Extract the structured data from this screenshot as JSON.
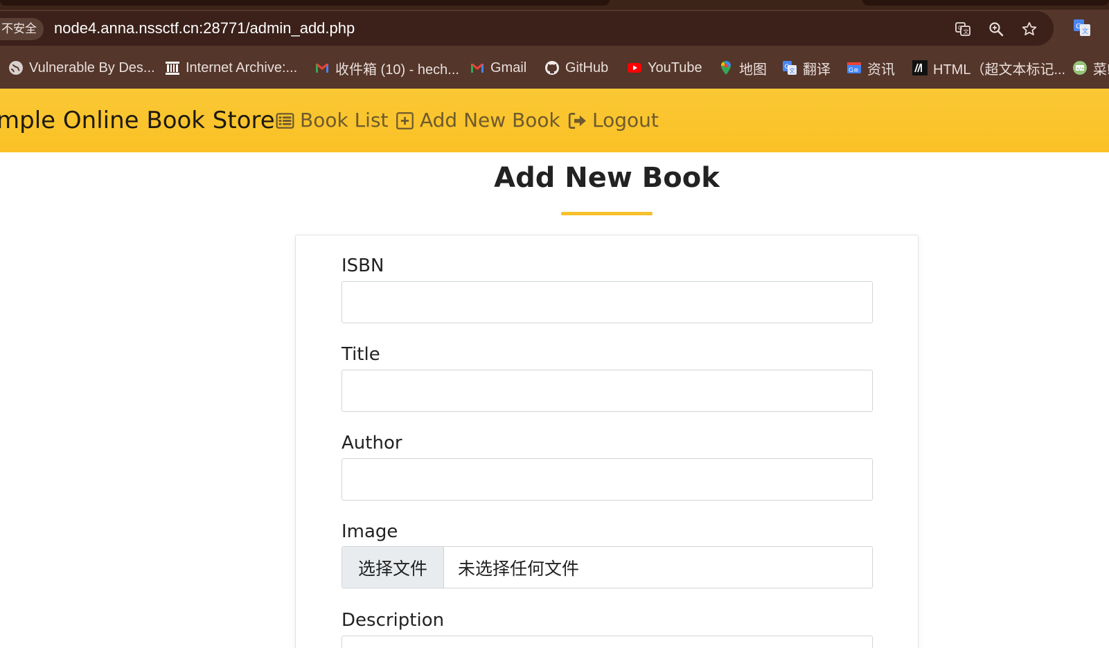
{
  "browser": {
    "security_label": "不安全",
    "url": "node4.anna.nssctf.cn:28771/admin_add.php",
    "bookmarks": [
      {
        "label": "Vulnerable By Des...",
        "icon": "globe-icon"
      },
      {
        "label": "Internet Archive:...",
        "icon": "archive-icon"
      },
      {
        "label": "收件箱 (10) - hech...",
        "icon": "gmail-icon"
      },
      {
        "label": "Gmail",
        "icon": "gmail-icon"
      },
      {
        "label": "GitHub",
        "icon": "github-icon"
      },
      {
        "label": "YouTube",
        "icon": "youtube-icon"
      },
      {
        "label": "地图",
        "icon": "maps-icon"
      },
      {
        "label": "翻译",
        "icon": "translate-icon"
      },
      {
        "label": "资讯",
        "icon": "news-icon"
      },
      {
        "label": "HTML（超文本标记...",
        "icon": "mdn-icon"
      },
      {
        "label": "菜!",
        "icon": "runoob-icon"
      }
    ]
  },
  "navbar": {
    "brand": "Simple Online Book Store",
    "links": [
      {
        "label": "Book List",
        "icon": "list-icon"
      },
      {
        "label": "Add New Book",
        "icon": "plus-square-icon"
      },
      {
        "label": "Logout",
        "icon": "logout-icon"
      }
    ]
  },
  "page": {
    "title": "Add New Book",
    "fields": {
      "isbn_label": "ISBN",
      "isbn_value": "",
      "title_label": "Title",
      "title_value": "",
      "author_label": "Author",
      "author_value": "",
      "image_label": "Image",
      "image_button": "选择文件",
      "image_status": "未选择任何文件",
      "description_label": "Description"
    }
  },
  "colors": {
    "chrome_dark": "#3b211a",
    "chrome_bar": "#54362b",
    "navbar_yellow": "#fbc52e",
    "accent_underline": "#f5c02c"
  }
}
